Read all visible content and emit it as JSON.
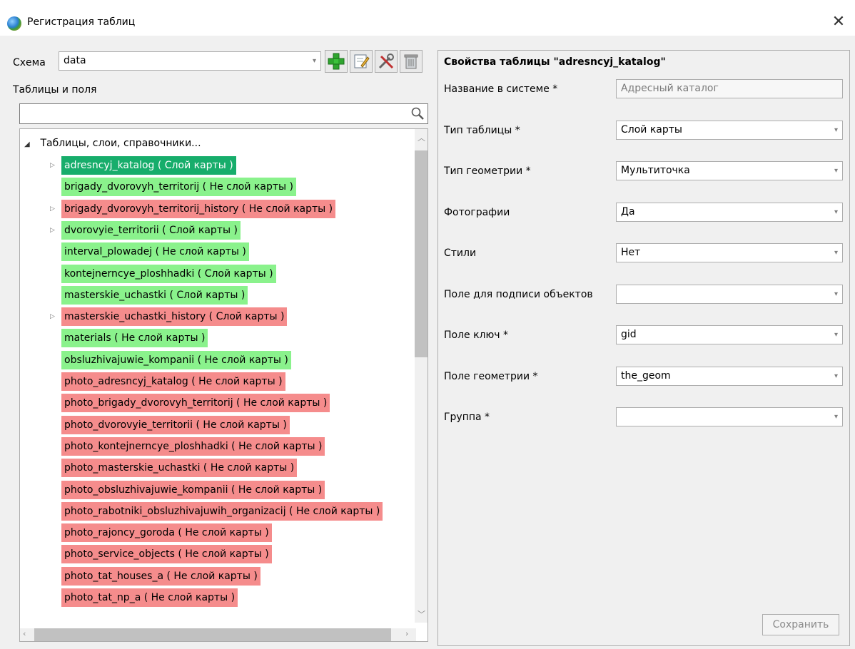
{
  "window": {
    "title": "Регистрация таблиц"
  },
  "left": {
    "schema_label": "Схема",
    "schema_value": "data",
    "tables_label": "Таблицы и поля",
    "search_value": "",
    "tree": {
      "root_label": "Таблицы, слои, справочники...",
      "items": [
        {
          "label": "adresncyj_katalog  ( Слой карты )",
          "status": "selected",
          "expandable": true
        },
        {
          "label": "brigady_dvorovyh_territorij  ( Не слой карты )",
          "status": "green",
          "expandable": false
        },
        {
          "label": "brigady_dvorovyh_territorij_history  ( Не слой карты )",
          "status": "red",
          "expandable": true
        },
        {
          "label": "dvorovyie_territorii  ( Слой карты )",
          "status": "green",
          "expandable": true
        },
        {
          "label": "interval_plowadej  ( Не слой карты )",
          "status": "green",
          "expandable": false
        },
        {
          "label": "kontejnerncye_ploshhadki  ( Слой карты )",
          "status": "green",
          "expandable": false
        },
        {
          "label": "masterskie_uchastki  ( Слой карты )",
          "status": "green",
          "expandable": false
        },
        {
          "label": "masterskie_uchastki_history  ( Слой карты )",
          "status": "red",
          "expandable": true
        },
        {
          "label": "materials  ( Не слой карты )",
          "status": "green",
          "expandable": false
        },
        {
          "label": "obsluzhivajuwie_kompanii  ( Не слой карты )",
          "status": "green",
          "expandable": false
        },
        {
          "label": "photo_adresncyj_katalog  ( Не слой карты )",
          "status": "red",
          "expandable": false
        },
        {
          "label": "photo_brigady_dvorovyh_territorij  ( Не слой карты )",
          "status": "red",
          "expandable": false
        },
        {
          "label": "photo_dvorovyie_territorii  ( Не слой карты )",
          "status": "red",
          "expandable": false
        },
        {
          "label": "photo_kontejnerncye_ploshhadki  ( Не слой карты )",
          "status": "red",
          "expandable": false
        },
        {
          "label": "photo_masterskie_uchastki  ( Не слой карты )",
          "status": "red",
          "expandable": false
        },
        {
          "label": "photo_obsluzhivajuwie_kompanii  ( Не слой карты )",
          "status": "red",
          "expandable": false
        },
        {
          "label": "photo_rabotniki_obsluzhivajuwih_organizacij  ( Не слой карты )",
          "status": "red",
          "expandable": false
        },
        {
          "label": "photo_rajoncy_goroda  ( Не слой карты )",
          "status": "red",
          "expandable": false
        },
        {
          "label": "photo_service_objects  ( Не слой карты )",
          "status": "red",
          "expandable": false
        },
        {
          "label": "photo_tat_houses_a  ( Не слой карты )",
          "status": "red",
          "expandable": false
        },
        {
          "label": "photo_tat_np_a  ( Не слой карты )",
          "status": "red",
          "expandable": false
        }
      ]
    }
  },
  "right": {
    "title": "Свойства таблицы \"adresncyj_katalog\"",
    "fields": [
      {
        "label": "Название в системе *",
        "value": "Адресный каталог",
        "kind": "text"
      },
      {
        "label": "Тип таблицы *",
        "value": "Слой карты",
        "kind": "combo"
      },
      {
        "label": "Тип геометрии *",
        "value": "Мультиточка",
        "kind": "combo"
      },
      {
        "label": "Фотографии",
        "value": "Да",
        "kind": "combo"
      },
      {
        "label": "Стили",
        "value": "Нет",
        "kind": "combo"
      },
      {
        "label": "Поле для подписи объектов",
        "value": "",
        "kind": "combo"
      },
      {
        "label": "Поле ключ *",
        "value": "gid",
        "kind": "combo"
      },
      {
        "label": "Поле геометрии *",
        "value": "the_geom",
        "kind": "combo"
      },
      {
        "label": "Группа *",
        "value": "",
        "kind": "combo"
      }
    ],
    "save_label": "Сохранить"
  },
  "icons": [
    "globe-app-icon",
    "close-icon",
    "add-icon",
    "edit-icon",
    "tools-icon",
    "delete-icon",
    "search-icon",
    "chevron-down-icon"
  ]
}
